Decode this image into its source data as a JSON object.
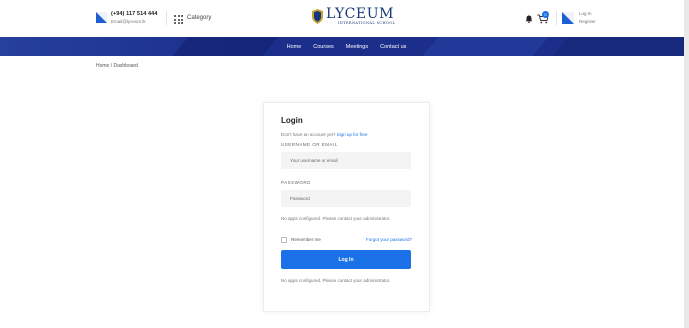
{
  "header": {
    "phone": "(+94) 117 514 444",
    "email": "Email@lyceum.lk",
    "category_label": "Category",
    "logo": {
      "name": "LYCEUM",
      "subtitle": "INTERNATIONAL SCHOOL"
    },
    "cart_count": "0",
    "login_label": "Log In",
    "register_label": "Register",
    "icons": [
      "phone-icon",
      "grid-icon",
      "shield-logo-icon",
      "bell-icon",
      "cart-icon",
      "user-icon"
    ]
  },
  "nav": {
    "items": [
      {
        "label": "Home"
      },
      {
        "label": "Courses"
      },
      {
        "label": "Meetings"
      },
      {
        "label": "Contact us"
      }
    ]
  },
  "breadcrumb": "Home / Dashboard",
  "login": {
    "title": "Login",
    "signup_prompt": "Don't have an account yet?",
    "signup_link": "Sign up for free",
    "username_label": "USERNAME OR EMAIL",
    "username_placeholder": "Your username or email",
    "password_label": "PASSWORD",
    "password_placeholder": "Password",
    "no_apps_note": "No apps configured. Please contact your administrator.",
    "remember_label": "Remember me",
    "forgot_link": "Forgot your password?",
    "submit_label": "Log In",
    "footer_note": "No apps configured. Please contact your administrator."
  },
  "colors": {
    "brand_blue": "#17377a",
    "nav_band": "#1b2f8a",
    "accent": "#1b72e8"
  }
}
